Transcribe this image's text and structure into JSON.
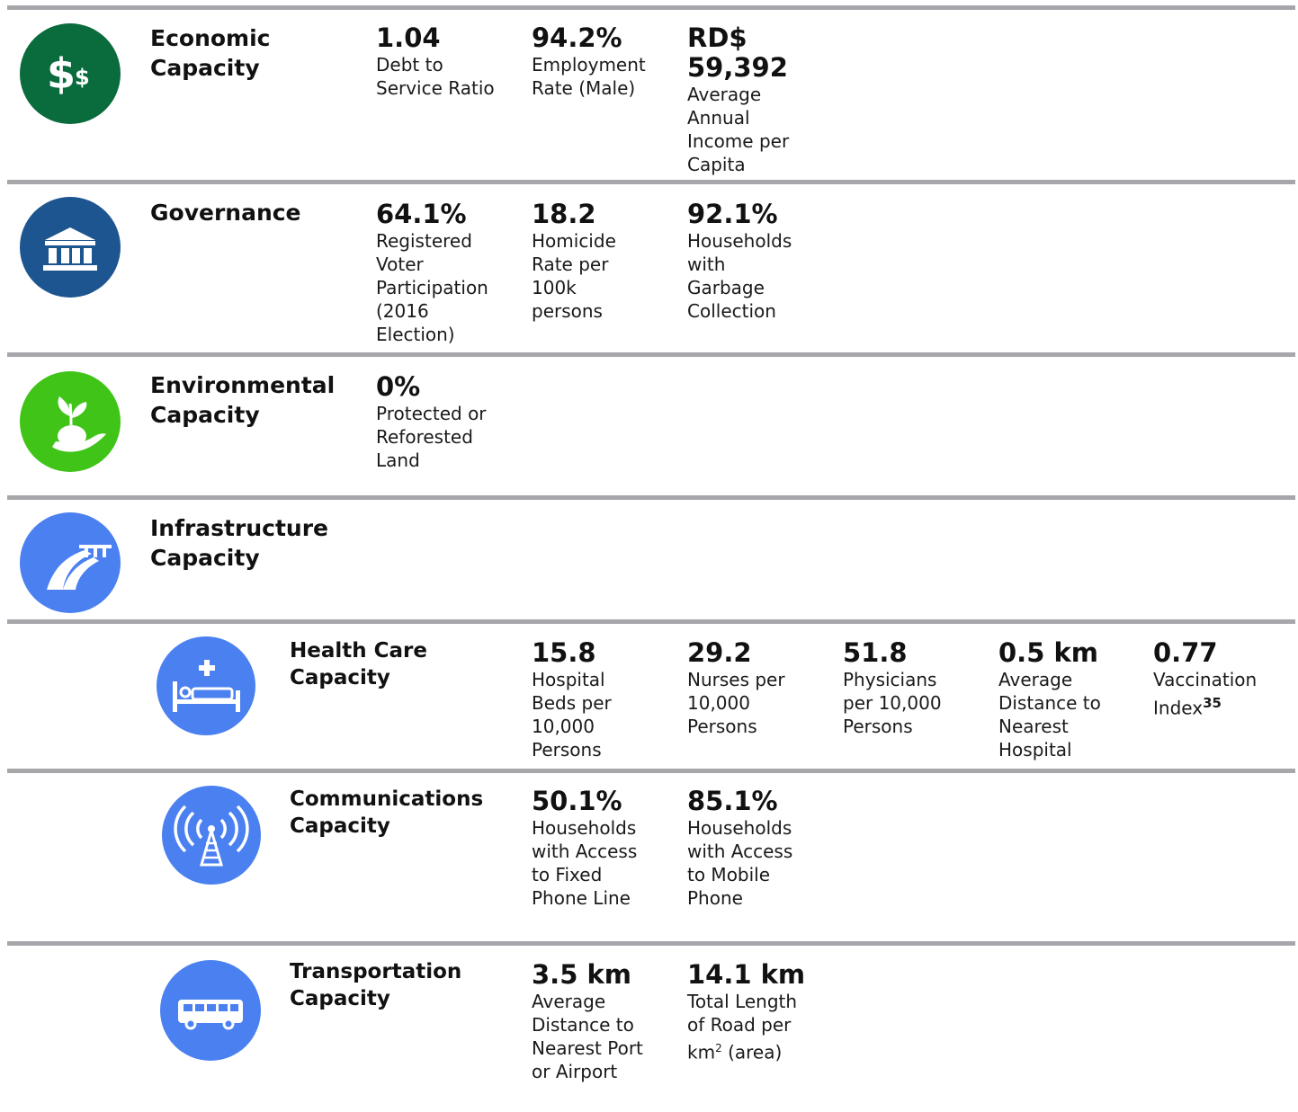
{
  "sections": {
    "economic": {
      "title": "Economic\nCapacity",
      "icon": "dollar-sign-icon",
      "color": "#0a6b3d",
      "stats": [
        {
          "value": "1.04",
          "desc": "Debt to\nService Ratio"
        },
        {
          "value": "94.2%",
          "desc": "Employment\nRate (Male)"
        },
        {
          "value": "RD$\n59,392",
          "desc": "Average\nAnnual\nIncome per\nCapita"
        }
      ]
    },
    "governance": {
      "title": "Governance",
      "icon": "government-building-icon",
      "color": "#1d5590",
      "stats": [
        {
          "value": "64.1%",
          "desc": "Registered\nVoter\nParticipation\n(2016\nElection)"
        },
        {
          "value": "18.2",
          "desc": "Homicide\nRate per\n100k\npersons"
        },
        {
          "value": "92.1%",
          "desc": "Households\nwith\nGarbage\nCollection"
        }
      ]
    },
    "environmental": {
      "title": "Environmental\nCapacity",
      "icon": "hand-with-plant-icon",
      "color": "#3fc417",
      "stats": [
        {
          "value": "0%",
          "desc": "Protected or\nReforested\nLand"
        }
      ]
    },
    "infrastructure": {
      "title": "Infrastructure\nCapacity",
      "icon": "road-bridge-icon",
      "color": "#4b80f0"
    },
    "health": {
      "title": "Health Care\nCapacity",
      "icon": "hospital-bed-icon",
      "color": "#4b80f0",
      "stats": [
        {
          "value": "15.8",
          "desc": "Hospital\nBeds per\n10,000\nPersons"
        },
        {
          "value": "29.2",
          "desc": "Nurses per\n10,000\nPersons"
        },
        {
          "value": "51.8",
          "desc": "Physicians\nper 10,000\nPersons"
        },
        {
          "value": "0.5 km",
          "desc": "Average\nDistance to\nNearest\nHospital"
        },
        {
          "value": "0.77",
          "desc": "Vaccination\nIndex",
          "footnote": "35"
        }
      ]
    },
    "communications": {
      "title": "Communications\nCapacity",
      "icon": "radio-tower-icon",
      "color": "#4b80f0",
      "stats": [
        {
          "value": "50.1%",
          "desc": "Households\nwith Access\nto Fixed\nPhone Line"
        },
        {
          "value": "85.1%",
          "desc": "Households\nwith Access\nto Mobile\nPhone"
        }
      ]
    },
    "transportation": {
      "title": "Transportation\nCapacity",
      "icon": "bus-icon",
      "color": "#4b80f0",
      "stats": [
        {
          "value": "3.5 km",
          "desc": "Average\nDistance to\nNearest Port\nor Airport"
        },
        {
          "value": "14.1 km",
          "desc": "Total Length\nof Road per\nkm",
          "sup": "2",
          "suffix": " (area)"
        }
      ]
    }
  }
}
